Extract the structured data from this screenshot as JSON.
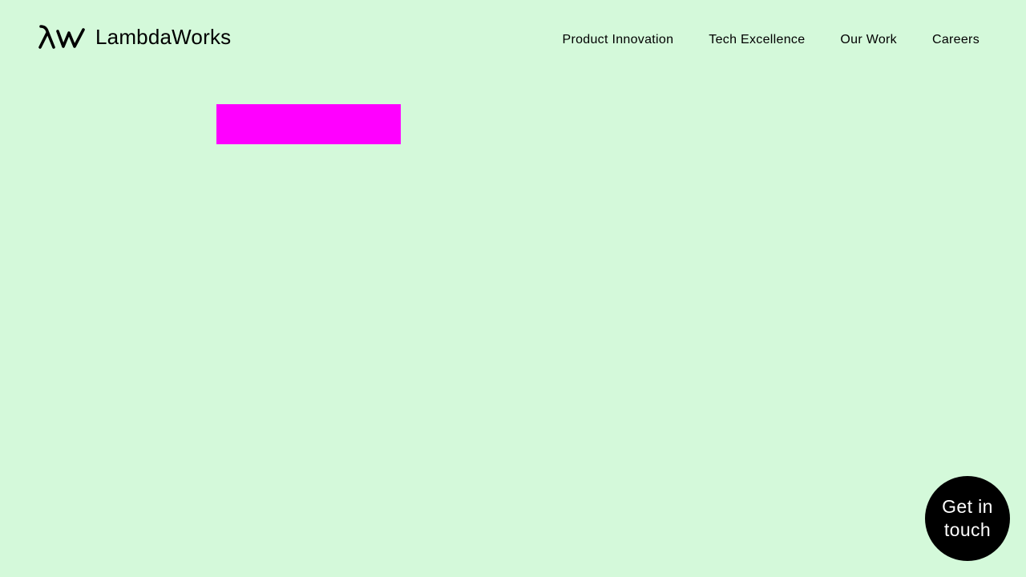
{
  "brand": {
    "name": "LambdaWorks",
    "logo_icon": "lambda-w-logo-icon"
  },
  "nav": {
    "items": [
      {
        "label": "Product Innovation"
      },
      {
        "label": "Tech Excellence"
      },
      {
        "label": "Our Work"
      },
      {
        "label": "Careers"
      }
    ]
  },
  "cta": {
    "label": "Get in touch"
  },
  "colors": {
    "background": "#d4f9da",
    "text": "#000000",
    "cta_background": "#000000",
    "cta_text": "#ffffff",
    "placeholder_block": "#ff00ff"
  }
}
